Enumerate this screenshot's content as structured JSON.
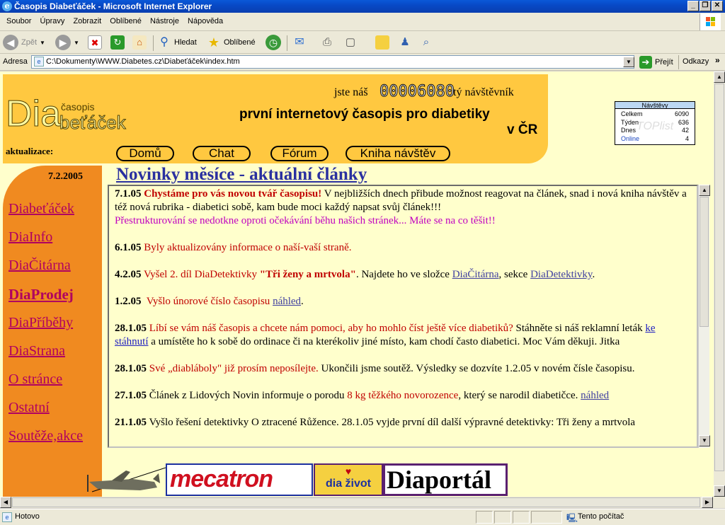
{
  "window": {
    "title": "Časopis Diabeťáček - Microsoft Internet Explorer",
    "controls": [
      "_",
      "❐",
      "✕"
    ]
  },
  "menu": [
    "Soubor",
    "Úpravy",
    "Zobrazit",
    "Oblíbené",
    "Nástroje",
    "Nápověda"
  ],
  "toolbar": {
    "back": "Zpět",
    "search": "Hledat",
    "favorites": "Oblíbené"
  },
  "address": {
    "label": "Adresa",
    "url": "C:\\Dokumenty\\WWW.Diabetes.cz\\Diabeťáček\\index.htm",
    "go": "Přejít",
    "links": "Odkazy"
  },
  "site": {
    "logo_main": "Dia",
    "logo_small": "časopis",
    "logo_rest": "beťáček",
    "visitor_pre": "jste náš",
    "visitor_count": "00006080",
    "visitor_post": "tý návštěvník",
    "tagline_1": "první internetový časopis pro diabetiky",
    "tagline_2": "v ČR",
    "update_label": "aktualizace:",
    "update_date": "7.2.2005",
    "nav": [
      "Domů",
      "Chat",
      "Fórum",
      "Kniha návštěv"
    ],
    "heading": "Novinky měsíce - aktuální články",
    "sidebar": [
      "Diabeťáček",
      "DiaInfo",
      "DiaČitárna",
      "DiaProdej",
      "DiaPříběhy",
      "DiaStrana",
      "O stránce",
      "Ostatní",
      "Soutěže,akce"
    ]
  },
  "counter": {
    "title": "Návštěvy",
    "rows": [
      {
        "label": "Celkem",
        "value": "6090"
      },
      {
        "label": "Týden",
        "value": "636"
      },
      {
        "label": "Dnes",
        "value": "42"
      },
      {
        "label": "Online",
        "value": "4"
      }
    ],
    "watermark": "TOPlist"
  },
  "news": [
    {
      "date": "7.1.05",
      "a": "Chystáme pro vás novou tvář časopisu!",
      "b": " V nejbližších dnech přibude možnost reagovat na článek, snad i nová kniha návštěv a též nová rubrika - diabetici sobě, kam bude moci každý napsat svůj článek!!!",
      "c": "Přestrukturování se nedotkne oproti očekávání běhu našich stránek... Máte se na co těšit!!"
    },
    {
      "date": "6.1.05",
      "a": "Byly aktualizovány informace o naší-vaší straně."
    },
    {
      "date": "4.2.05",
      "a": "Vyšel 2. díl DiaDetektivky ",
      "q": "\"Tři ženy a mrtvola\"",
      "b": ". Najdete ho ve složce ",
      "l1": "DiaČitárna",
      "m": ", sekce ",
      "l2": "DiaDetektivky",
      "e": "."
    },
    {
      "date": "1.2.05",
      "a": "Vyšlo únorové číslo časopisu",
      "l1": "náhled",
      "e": "."
    },
    {
      "date": "28.1.05",
      "a": "Líbí se vám náš časopis a chcete nám pomoci, aby ho mohlo číst ještě více diabetiků?",
      "b": " Stáhněte si náš reklamní leták ",
      "l1": "ke stáhnutí",
      "e": " a umístěte ho k sobě do ordinace či na kterékoliv jiné místo, kam chodí často diabetici. Moc Vám děkuji. Jitka"
    },
    {
      "date": "28.1.05",
      "a": "Své „diablábolу\" již prosím neposílejte.",
      "b": " Ukončili jsme soutěž. Výsledky se dozvíte 1.2.05 v novém čísle časopisu."
    },
    {
      "date": "27.1.05",
      "b": "Článek z Lidových Novin informuje o porodu ",
      "a": "8 kg těžkého novorozence",
      "m": ", který se narodil diabetičce. ",
      "l1": "náhled"
    },
    {
      "date": "21.1.05",
      "b": "Vyšlo řešení detektivky O ztracené Růžence. 28.1.05 vyjde první díl další výpravné detektivky: Tři ženy a mrtvola"
    }
  ],
  "banners": {
    "b1": "mecatron",
    "b2": "dia život",
    "b3": "Diaportál"
  },
  "status": {
    "text": "Hotovo",
    "zone": "Tento počítač"
  }
}
